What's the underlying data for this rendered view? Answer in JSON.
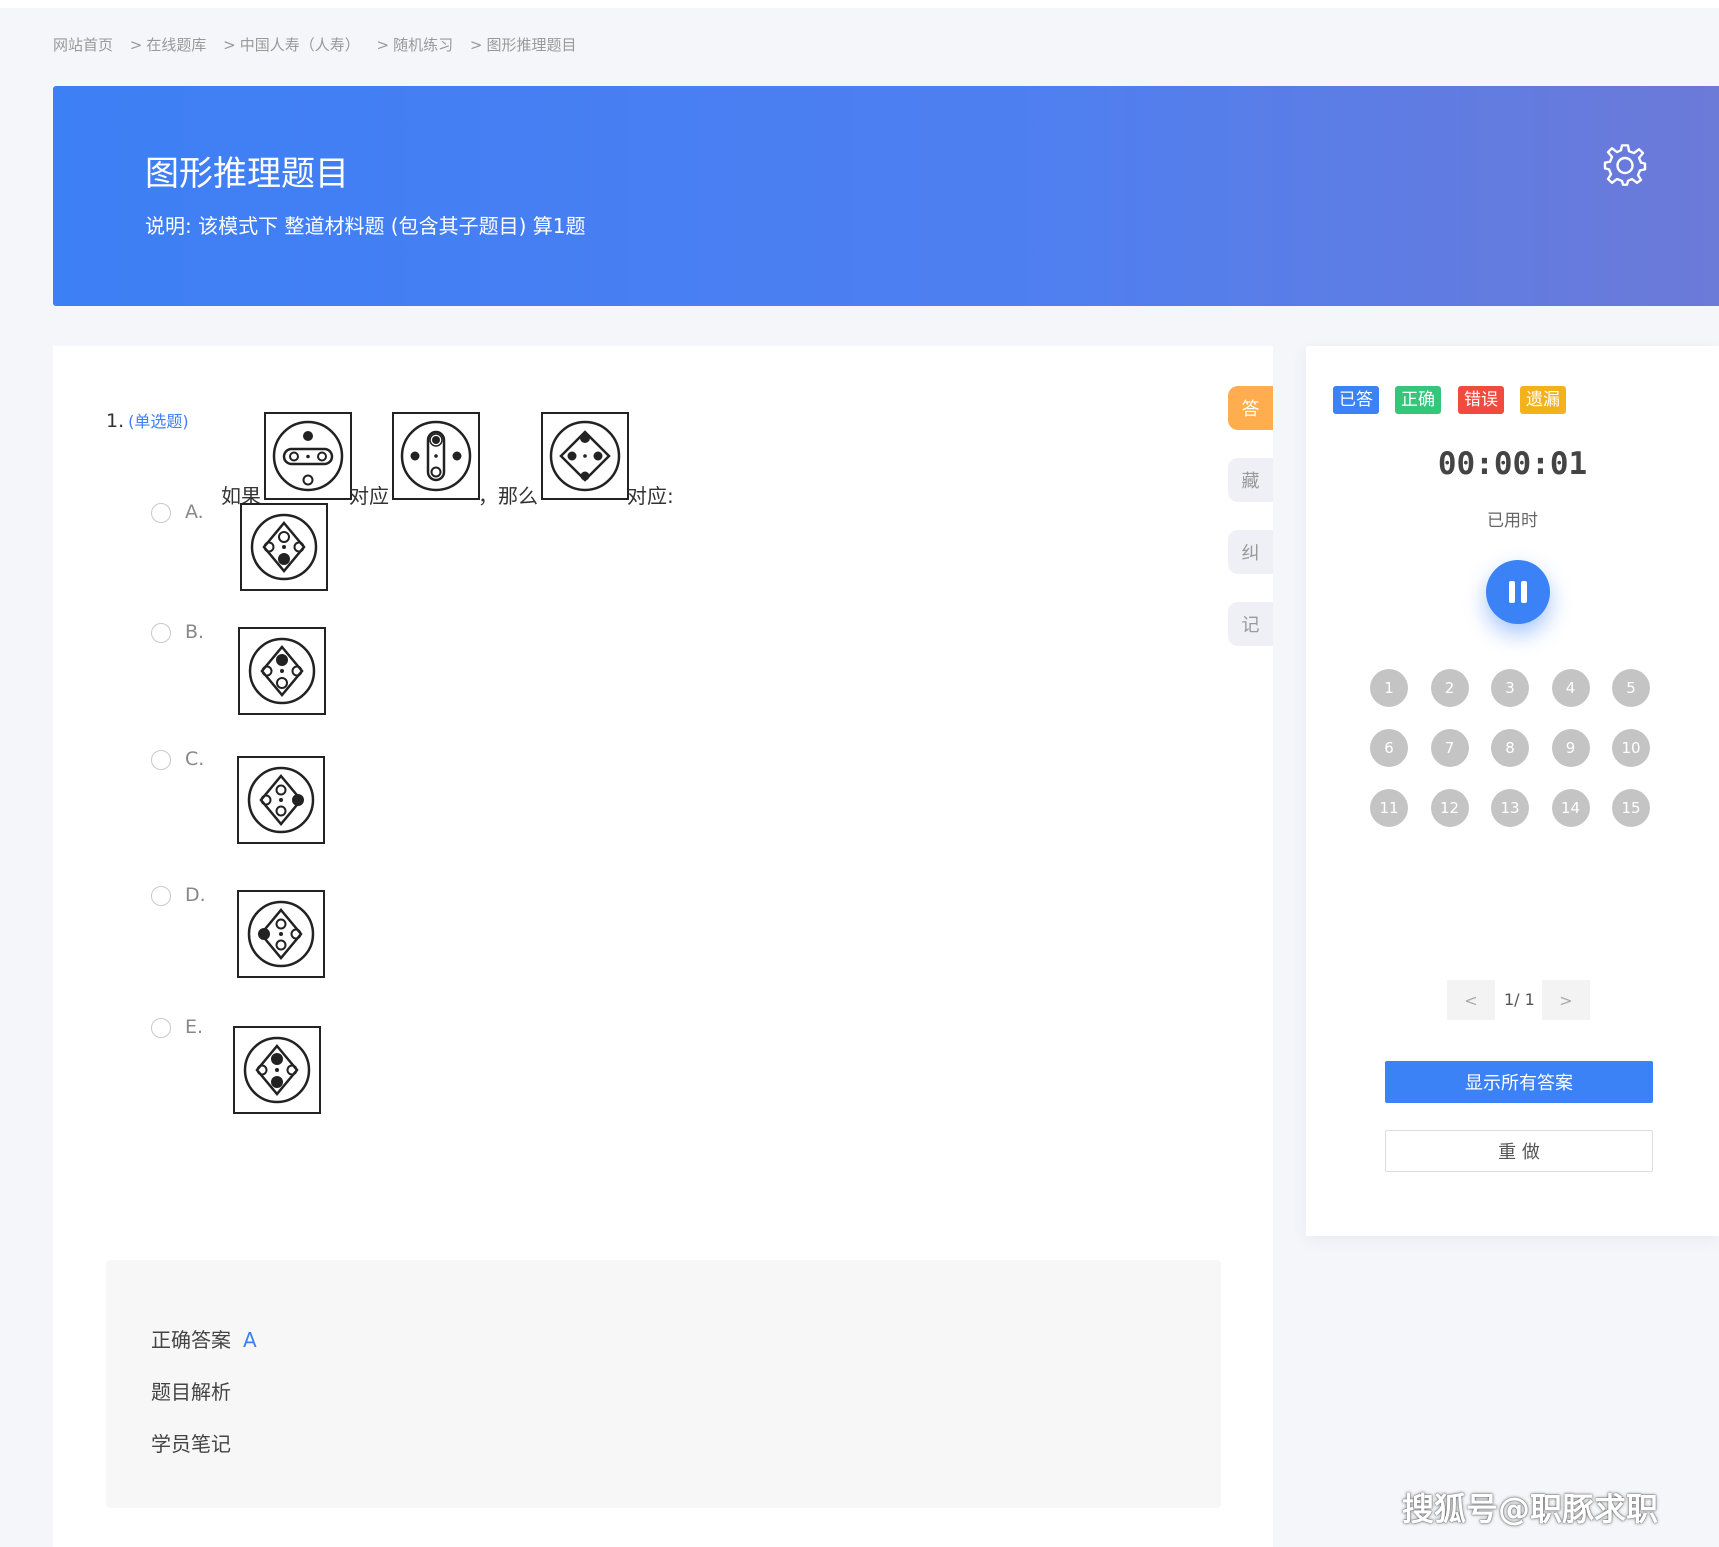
{
  "breadcrumb": [
    "网站首页",
    "在线题库",
    "中国人寿（人寿）",
    "随机练习",
    "图形推理题目"
  ],
  "breadcrumb_sep": ">",
  "banner": {
    "title": "图形推理题目",
    "description": "说明:   该模式下 整道材料题 (包含其子题目) 算1题"
  },
  "question": {
    "number": "1.",
    "type": "(单选题)",
    "stem_words": [
      "如果",
      "对应",
      "，那么",
      "对应:"
    ],
    "options": [
      "A.",
      "B.",
      "C.",
      "D.",
      "E."
    ]
  },
  "answer": {
    "correct_label": "正确答案",
    "correct_value": "A",
    "analysis_label": "题目解析",
    "notes_label": "学员笔记"
  },
  "side_tabs": [
    "答",
    "藏",
    "纠",
    "记"
  ],
  "status_legend": [
    {
      "label": "已答",
      "color": "#3b82f6"
    },
    {
      "label": "正确",
      "color": "#34c77b"
    },
    {
      "label": "错误",
      "color": "#ef4b3f"
    },
    {
      "label": "遗漏",
      "color": "#f3b21b"
    }
  ],
  "timer": {
    "value": "00:00:01",
    "label": "已用时"
  },
  "question_numbers": [
    "1",
    "2",
    "3",
    "4",
    "5",
    "6",
    "7",
    "8",
    "9",
    "10",
    "11",
    "12",
    "13",
    "14",
    "15"
  ],
  "pager": {
    "prev": "<",
    "text": "1/ 1",
    "next": ">"
  },
  "buttons": {
    "show_all": "显示所有答案",
    "redo": "重 做"
  },
  "watermark": "搜狐号@职豚求职"
}
